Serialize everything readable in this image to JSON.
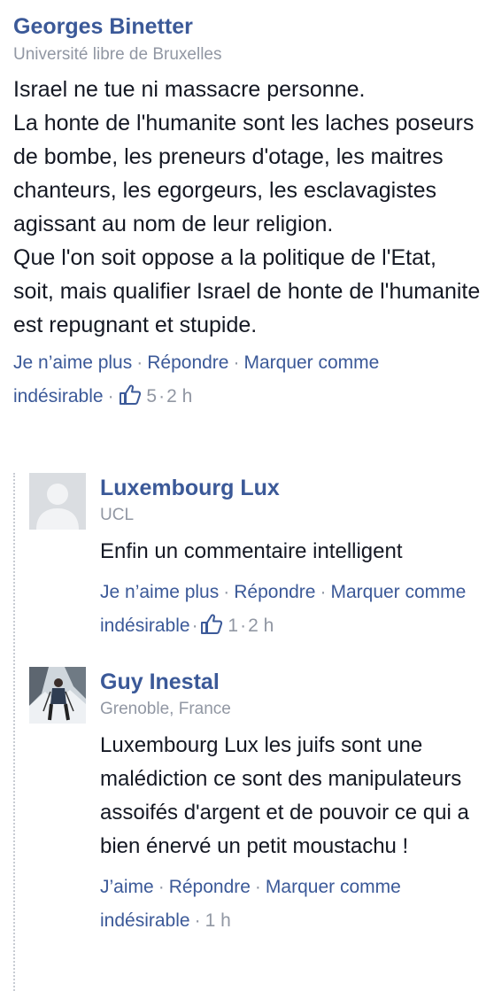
{
  "main_comment": {
    "author": "Georges Binetter",
    "affiliation": "Université libre de Bruxelles",
    "text_lines": [
      "Israel ne tue ni massacre personne.",
      "La honte de l'humanite sont les laches poseurs de bombe, les preneurs d'otage, les maitres chanteurs, les egorgeurs, les esclavagistes agissant au nom de leur religion.",
      "Que l'on soit oppose a la politique de l'Etat, soit, mais qualifier Israel de honte de l'humanite est repugnant et stupide."
    ],
    "actions": {
      "like": "Je n’aime plus",
      "reply": "Répondre",
      "mark": "Marquer comme indésirable",
      "like_count": "5",
      "time": "2 h"
    }
  },
  "replies": [
    {
      "author": "Luxembourg Lux",
      "affiliation": "UCL",
      "text": "Enfin un commentaire intelligent",
      "actions": {
        "like": "Je n’aime plus",
        "reply": "Répondre",
        "mark": "Marquer comme indésirable",
        "like_count": "1",
        "time": "2 h"
      }
    },
    {
      "author": "Guy Inestal",
      "affiliation": "Grenoble, France",
      "text": "Luxembourg Lux les juifs sont une malédiction ce sont des manipulateurs assoifés d'argent et de pouvoir ce qui a bien énervé un petit moustachu !",
      "actions": {
        "like": "J’aime",
        "reply": "Répondre",
        "mark": "Marquer comme indésirable",
        "time": "1 h"
      }
    }
  ],
  "separator": "·",
  "icons": {
    "like": "thumbs-up-icon",
    "default_avatar": "default-avatar-icon",
    "photo_avatar": "skier-photo-avatar"
  },
  "colors": {
    "link": "#3b5998",
    "meta": "#9197a3",
    "text": "#141823",
    "thread_line": "#c8ccd3"
  }
}
